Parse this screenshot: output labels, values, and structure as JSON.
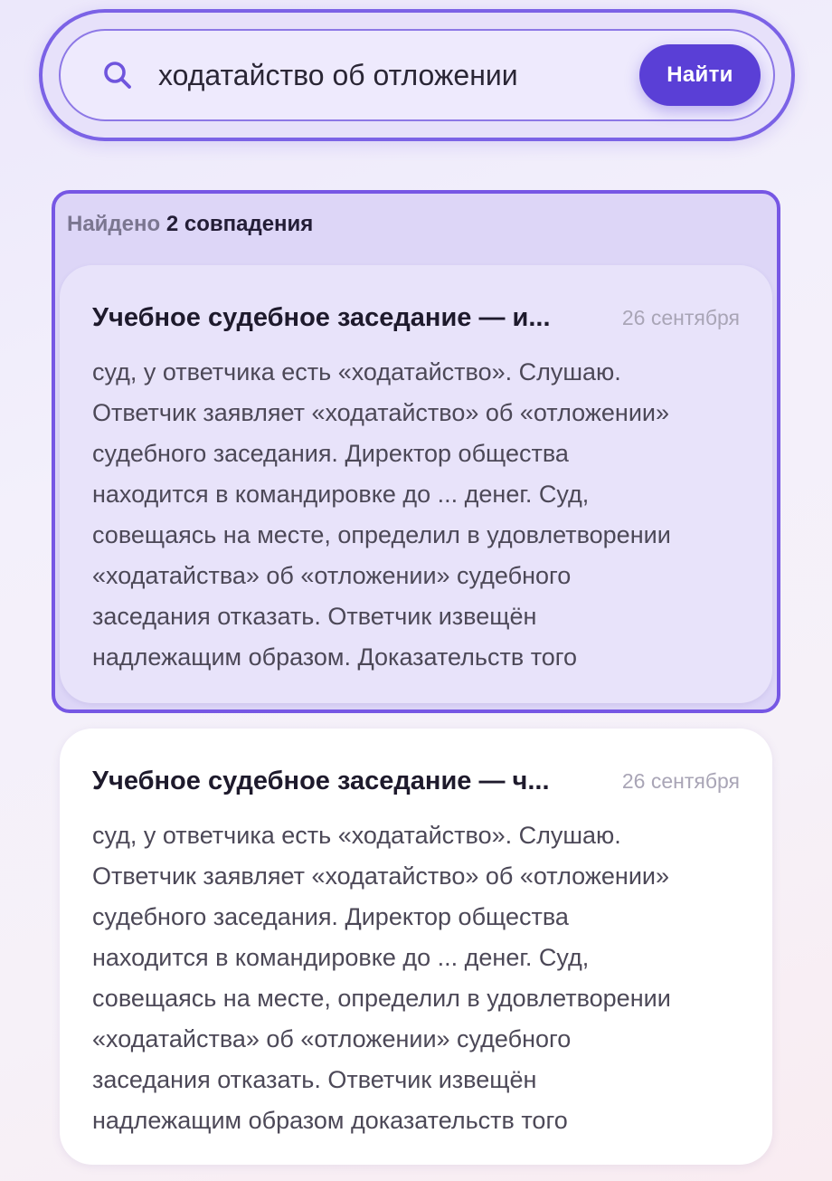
{
  "search": {
    "query": "ходатайство об отложении",
    "button_label": "Найти",
    "icon": "search-icon"
  },
  "results": {
    "found_prefix": "Найдено",
    "found_count": "2 совпадения",
    "items": [
      {
        "title": "Учебное судебное заседание — и...",
        "date": "26 сентября",
        "snippet": "суд, у ответчика есть «ходатайство». Слушаю.\nОтветчик заявляет «ходатайство» об «отложении»\nсудебного заседания. Директор общества\nнаходится в командировке до ... денег. Суд,\nсовещаясь на месте, определил в удовлетворении\n«ходатайства» об «отложении» судебного\nзаседания отказать. Ответчик извещён\nнадлежащим образом. Доказательств того",
        "selected": true
      },
      {
        "title": "Учебное судебное заседание — ч...",
        "date": "26 сентября",
        "snippet": "суд, у ответчика есть «ходатайство». Слушаю.\nОтветчик заявляет «ходатайство» об «отложении»\nсудебного заседания. Директор общества\nнаходится в командировке до ... денег. Суд,\nсовещаясь на месте, определил в удовлетворении\n«ходатайства» об «отложении» судебного\nзаседания отказать. Ответчик извещён\nнадлежащим образом доказательств того",
        "selected": false
      }
    ]
  },
  "colors": {
    "accent": "#5a3fd6",
    "accent_border": "#7657e4",
    "selected_card_bg": "#e8e3fa",
    "card_bg": "#ffffff",
    "date_text": "#a9a5b6"
  }
}
